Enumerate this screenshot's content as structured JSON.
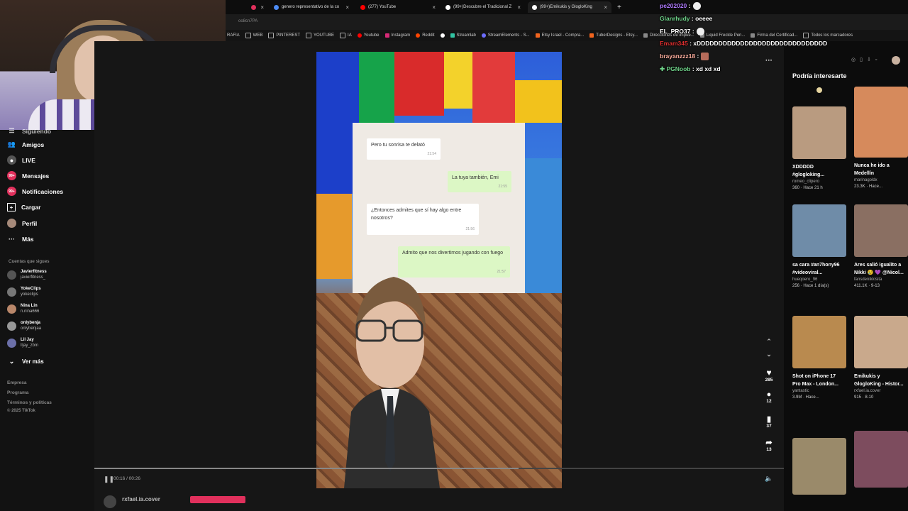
{
  "browser": {
    "tabs": [
      {
        "label": "",
        "color": "#e1305c"
      },
      {
        "label": "genero representativo de la co",
        "color": "#4c8bf5"
      },
      {
        "label": "(277) YouTube",
        "color": "#ff0000"
      },
      {
        "label": "(99+)Descubre el Tradicional Z",
        "color": "#ffffff"
      },
      {
        "label": "(99+)Emikukis y GlogloKing",
        "color": "#ffffff"
      }
    ],
    "url": "oo8cn7PA",
    "bookmarks": [
      "RAFIA",
      "WEB",
      "PINTEREST",
      "YOUTUBE",
      "IA",
      "Youtube",
      "Instagram",
      "Reddit",
      "",
      "Streamlab",
      "StreamElements - S...",
      "Etsy Israel - Compra...",
      "TuberDesigns - Etsy...",
      "Direcciones de impue...",
      "Liquid Freckle Pen...",
      "Firma del Certificad...",
      "Todos los marcadores"
    ]
  },
  "sidebar": {
    "items": [
      {
        "label": "Siguiendo",
        "icon": "following-icon"
      },
      {
        "label": "Amigos",
        "icon": "friends-icon"
      },
      {
        "label": "LIVE",
        "icon": "live-icon"
      },
      {
        "label": "Mensajes",
        "icon": "messages-icon",
        "badge": "99+"
      },
      {
        "label": "Notificaciones",
        "icon": "notifications-icon",
        "badge": "99+"
      },
      {
        "label": "Cargar",
        "icon": "upload-icon"
      },
      {
        "label": "Perfil",
        "icon": "profile-icon"
      },
      {
        "label": "Más",
        "icon": "more-icon"
      }
    ],
    "following_header": "Cuentas que sigues",
    "accounts": [
      {
        "name": "Javierfitness",
        "handle": "javierfitness_"
      },
      {
        "name": "YokeClips",
        "handle": "yokeclips"
      },
      {
        "name": "Nina Lin",
        "handle": "n.nina666"
      },
      {
        "name": "onlybenja",
        "handle": "onlybenjaa"
      },
      {
        "name": "Lil Jay",
        "handle": "lljay_zbm"
      }
    ],
    "see_more": "Ver más",
    "footer": [
      "Empresa",
      "Programa",
      "Términos y políticas",
      "© 2025 TikTok"
    ]
  },
  "video": {
    "messages": [
      {
        "text": "Pero tu sonrisa te delató",
        "time": "21:54",
        "dir": "in"
      },
      {
        "text": "La tuya también, Emi",
        "time": "21:55",
        "dir": "out"
      },
      {
        "text": "¿Entonces admites que sí hay algo entre nosotros?",
        "time": "21:56",
        "dir": "in"
      },
      {
        "text": "Admito que nos divertimos jugando con fuego",
        "time": "21:57",
        "dir": "out"
      }
    ],
    "time": "00:16 / 00:26",
    "progress": 0.615,
    "author": "rxfael.ia.cover",
    "actions": [
      {
        "icon": "like-icon",
        "count": "285"
      },
      {
        "icon": "comment-icon",
        "count": "12"
      },
      {
        "icon": "bookmark-icon",
        "count": "37"
      },
      {
        "icon": "share-icon",
        "count": "13"
      }
    ]
  },
  "recommendations": {
    "title": "Podría interesarte",
    "cards": [
      {
        "title": "XDDDDD",
        "subtitle": "#glogloking...",
        "author": "romeo_clipero",
        "stats": "360 · Hace 21 h",
        "bg": "#b99b80"
      },
      {
        "title": "Nunca he ido a",
        "subtitle": "Medellín",
        "author": "marinagoldx",
        "stats": "23.3K · Hace...",
        "bg": "#d68a5c"
      },
      {
        "title": "sa cara #an7hony96",
        "subtitle": "#videoviral...",
        "author": "hueqoero_96",
        "stats": "256 · Hace 1 día(s)",
        "bg": "#6f8ca8"
      },
      {
        "title": "Ares salió igualito a",
        "subtitle": "Nikki 😢 💜 @Nicol...",
        "author": "fansdenikkisita",
        "stats": "411.1K · 9-13",
        "bg": "#8a6f62"
      },
      {
        "title": "Shot on iPhone 17",
        "subtitle": "Pro Max - London...",
        "author": "yantastic",
        "stats": "3.9M · Hace...",
        "bg": "#b98a4f"
      },
      {
        "title": "Emikukis y",
        "subtitle": "GlogloKing - Histor...",
        "author": "rxfael.ia.cover",
        "stats": "915 · 8-10",
        "bg": "#c9a98c"
      },
      {
        "title": "",
        "subtitle": "",
        "author": "",
        "stats": "",
        "bg": "#9a8a6a"
      },
      {
        "title": "",
        "subtitle": "",
        "author": "",
        "stats": "",
        "bg": "#7d4c5e"
      }
    ]
  },
  "stream_chat": [
    {
      "user": "pe202020",
      "color": "#b07bff",
      "text": ""
    },
    {
      "user": "Glanrhudy",
      "color": "#6fd38a",
      "text": "oeeee"
    },
    {
      "user": "EL_PRO37",
      "color": "#ffffff",
      "text": ""
    },
    {
      "user": "Emam345",
      "color": "#e03030",
      "text": "xDDDDDDDDDDDDDDDDDDDDDDDDDDDDDD"
    },
    {
      "user": "brayanzzz18",
      "color": "#ffb0a0",
      "text": ""
    },
    {
      "user": "PGNoob",
      "color": "#6fd38a",
      "text": "xd xd xd"
    }
  ]
}
